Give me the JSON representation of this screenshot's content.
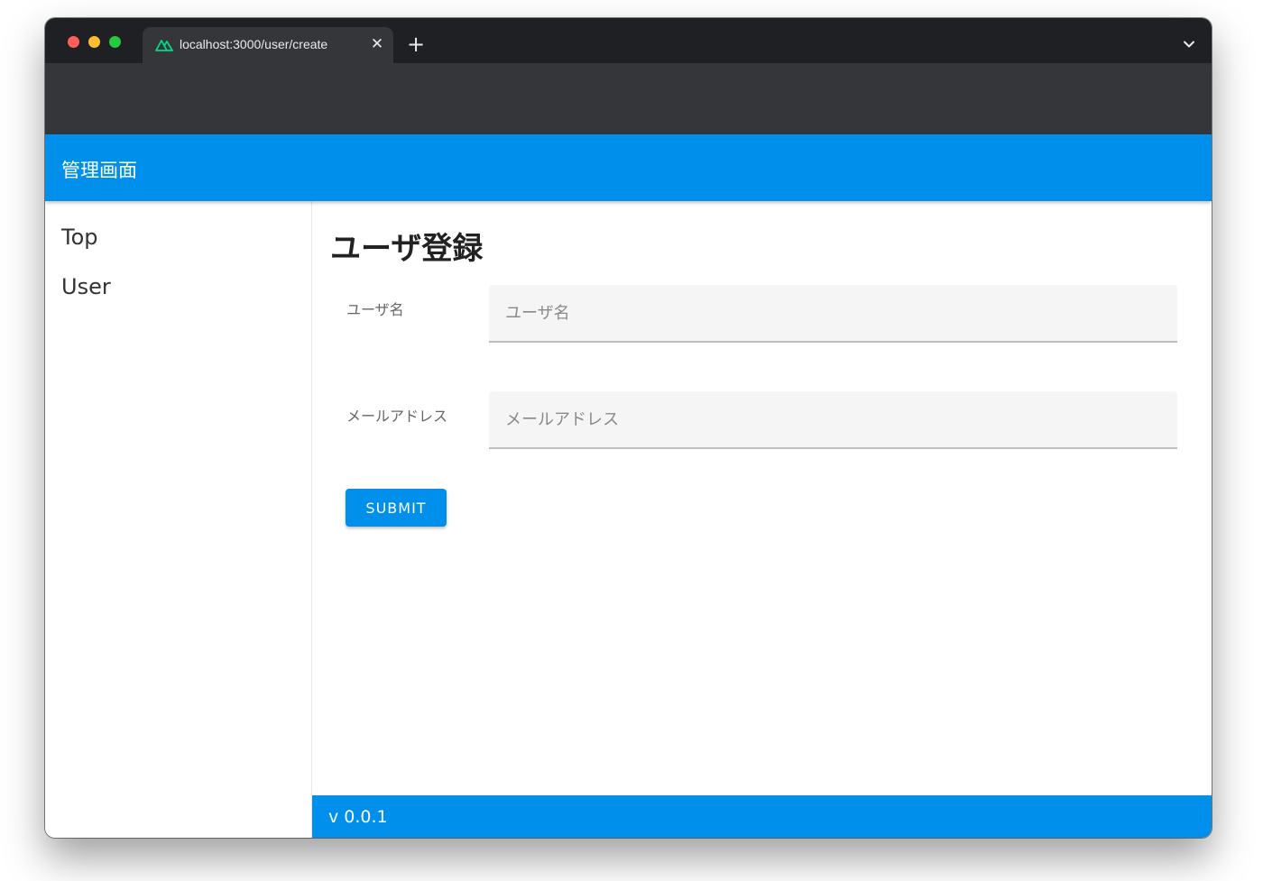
{
  "browser": {
    "tab_title": "localhost:3000/user/create",
    "tab_favicon": "nuxt-logo-icon",
    "close_symbol": "✕",
    "new_tab_symbol": "+",
    "dropdown_icon": "chevron-down-icon"
  },
  "header": {
    "title": "管理画面"
  },
  "sidebar": {
    "items": [
      {
        "label": "Top"
      },
      {
        "label": "User"
      }
    ]
  },
  "main": {
    "page_title": "ユーザ登録",
    "fields": [
      {
        "label": "ユーザ名",
        "placeholder": "ユーザ名",
        "value": ""
      },
      {
        "label": "メールアドレス",
        "placeholder": "メールアドレス",
        "value": ""
      }
    ],
    "submit_label": "SUBMIT"
  },
  "footer": {
    "version": "v 0.0.1"
  },
  "colors": {
    "primary": "#0090eb",
    "titlebar": "#1f2023",
    "toolbar": "#35363a",
    "field_background": "#f5f5f5"
  }
}
